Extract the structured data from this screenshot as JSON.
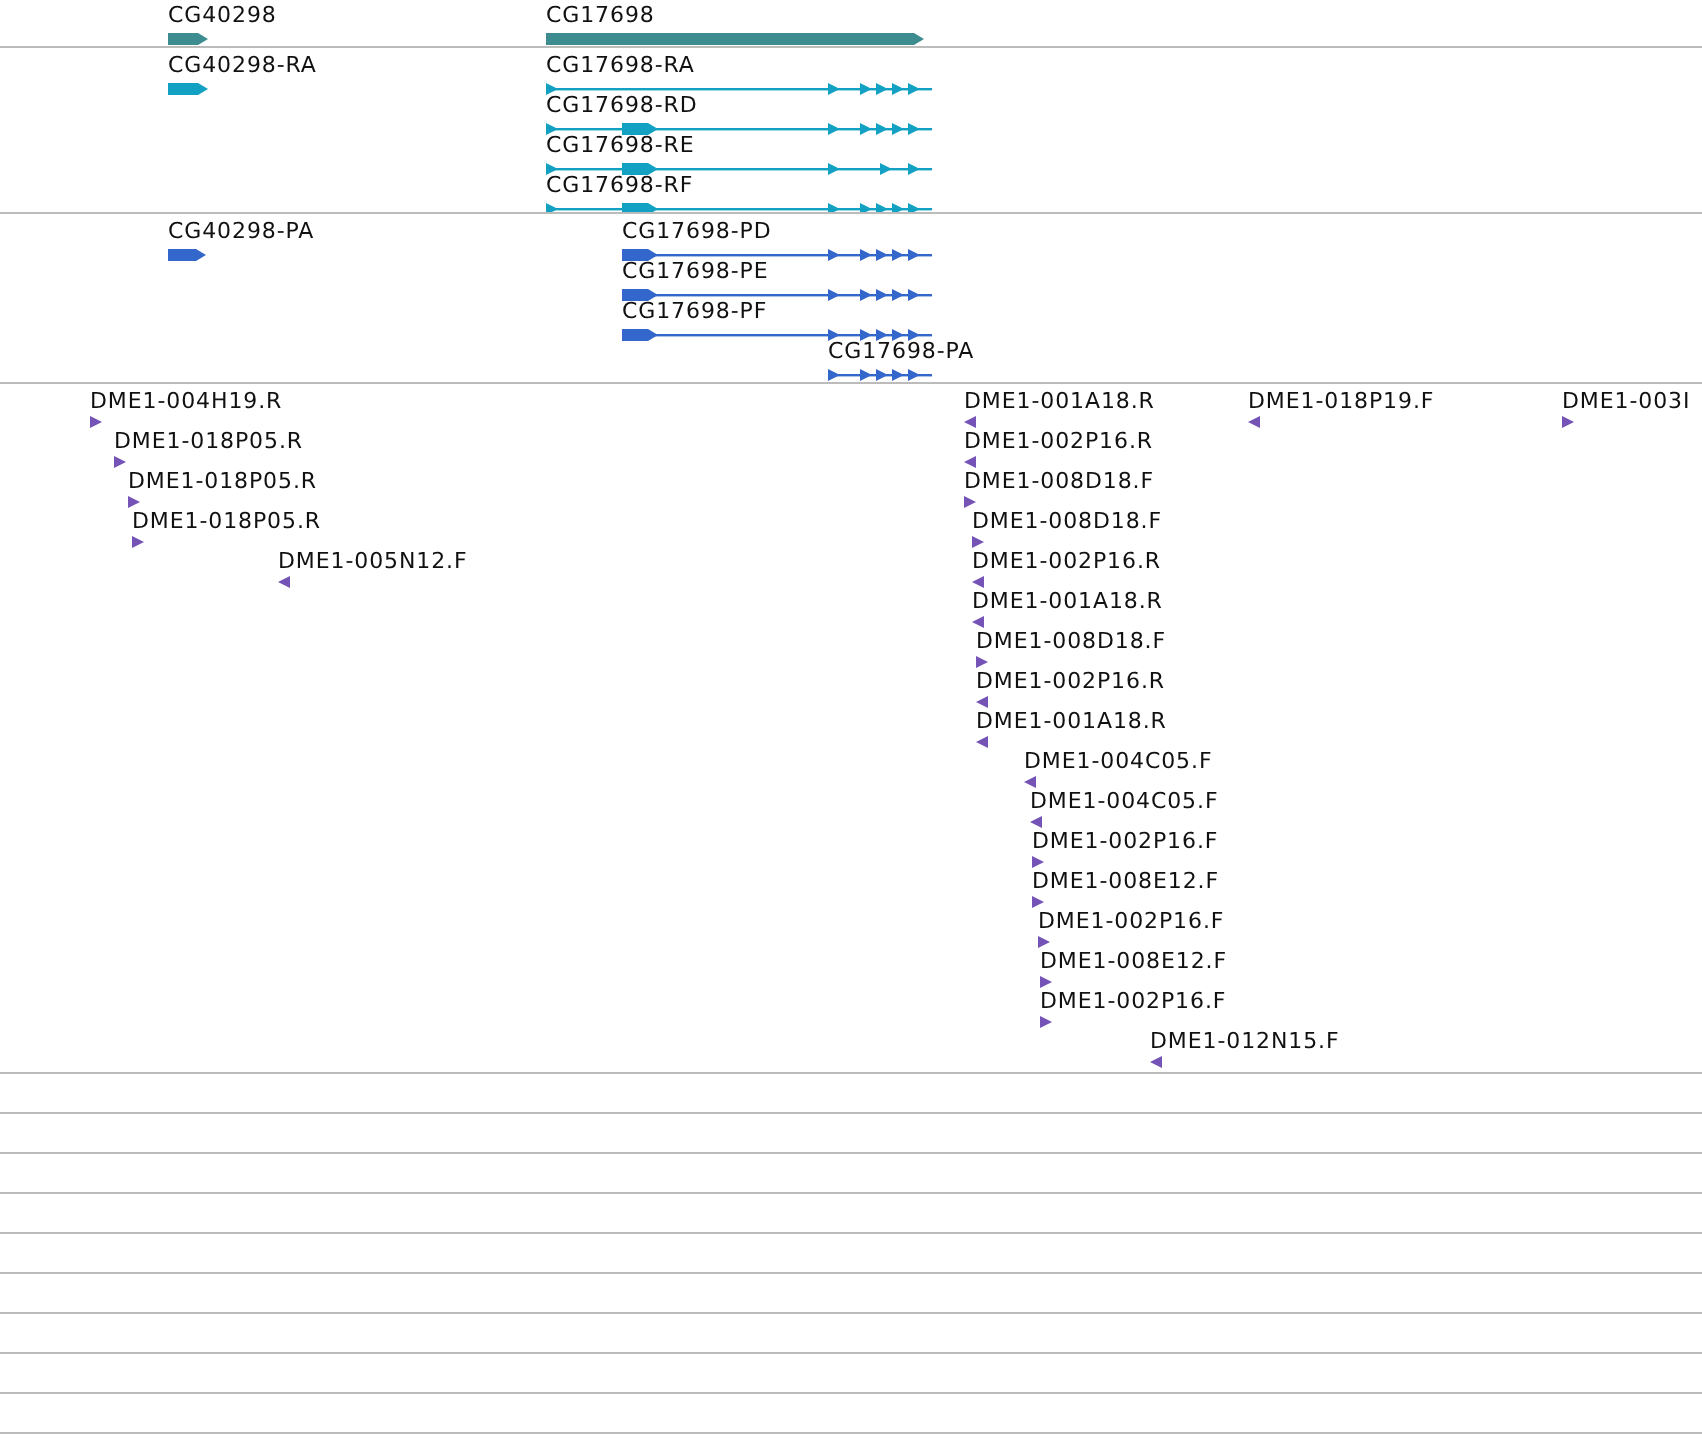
{
  "tracks": [
    {
      "kind": "gene",
      "features": [
        {
          "label": "CG40298",
          "reverse": false
        },
        {
          "label": "CG17698",
          "reverse": false
        }
      ]
    },
    {
      "kind": "transcript",
      "features": [
        {
          "label": "CG40298-RA",
          "reverse": false
        },
        {
          "label": "CG17698-RA",
          "reverse": false
        },
        {
          "label": "CG17698-RD",
          "reverse": false
        },
        {
          "label": "CG17698-RE",
          "reverse": false
        },
        {
          "label": "CG17698-RF",
          "reverse": false
        }
      ]
    },
    {
      "kind": "protein",
      "features": [
        {
          "label": "CG40298-PA",
          "reverse": false
        },
        {
          "label": "CG17698-PD",
          "reverse": false
        },
        {
          "label": "CG17698-PE",
          "reverse": false
        },
        {
          "label": "CG17698-PF",
          "reverse": false
        },
        {
          "label": "CG17698-PA",
          "reverse": false
        }
      ]
    },
    {
      "kind": "est",
      "features": [
        {
          "label": "DME1-004H19.R",
          "reverse": false
        },
        {
          "label": "DME1-018P05.R",
          "reverse": false
        },
        {
          "label": "DME1-018P05.R",
          "reverse": false
        },
        {
          "label": "DME1-018P05.R",
          "reverse": false
        },
        {
          "label": "DME1-005N12.F",
          "reverse": true
        },
        {
          "label": "DME1-001A18.R",
          "reverse": true
        },
        {
          "label": "DME1-018P19.F",
          "reverse": true
        },
        {
          "label": "DME1-003I",
          "reverse": false
        },
        {
          "label": "DME1-002P16.R",
          "reverse": true
        },
        {
          "label": "DME1-008D18.F",
          "reverse": false
        },
        {
          "label": "DME1-008D18.F",
          "reverse": false
        },
        {
          "label": "DME1-002P16.R",
          "reverse": true
        },
        {
          "label": "DME1-001A18.R",
          "reverse": true
        },
        {
          "label": "DME1-008D18.F",
          "reverse": false
        },
        {
          "label": "DME1-002P16.R",
          "reverse": true
        },
        {
          "label": "DME1-001A18.R",
          "reverse": true
        },
        {
          "label": "DME1-004C05.F",
          "reverse": true
        },
        {
          "label": "DME1-004C05.F",
          "reverse": true
        },
        {
          "label": "DME1-002P16.F",
          "reverse": false
        },
        {
          "label": "DME1-008E12.F",
          "reverse": false
        },
        {
          "label": "DME1-002P16.F",
          "reverse": false
        },
        {
          "label": "DME1-008E12.F",
          "reverse": false
        },
        {
          "label": "DME1-002P16.F",
          "reverse": false
        },
        {
          "label": "DME1-012N15.F",
          "reverse": true
        }
      ]
    }
  ]
}
